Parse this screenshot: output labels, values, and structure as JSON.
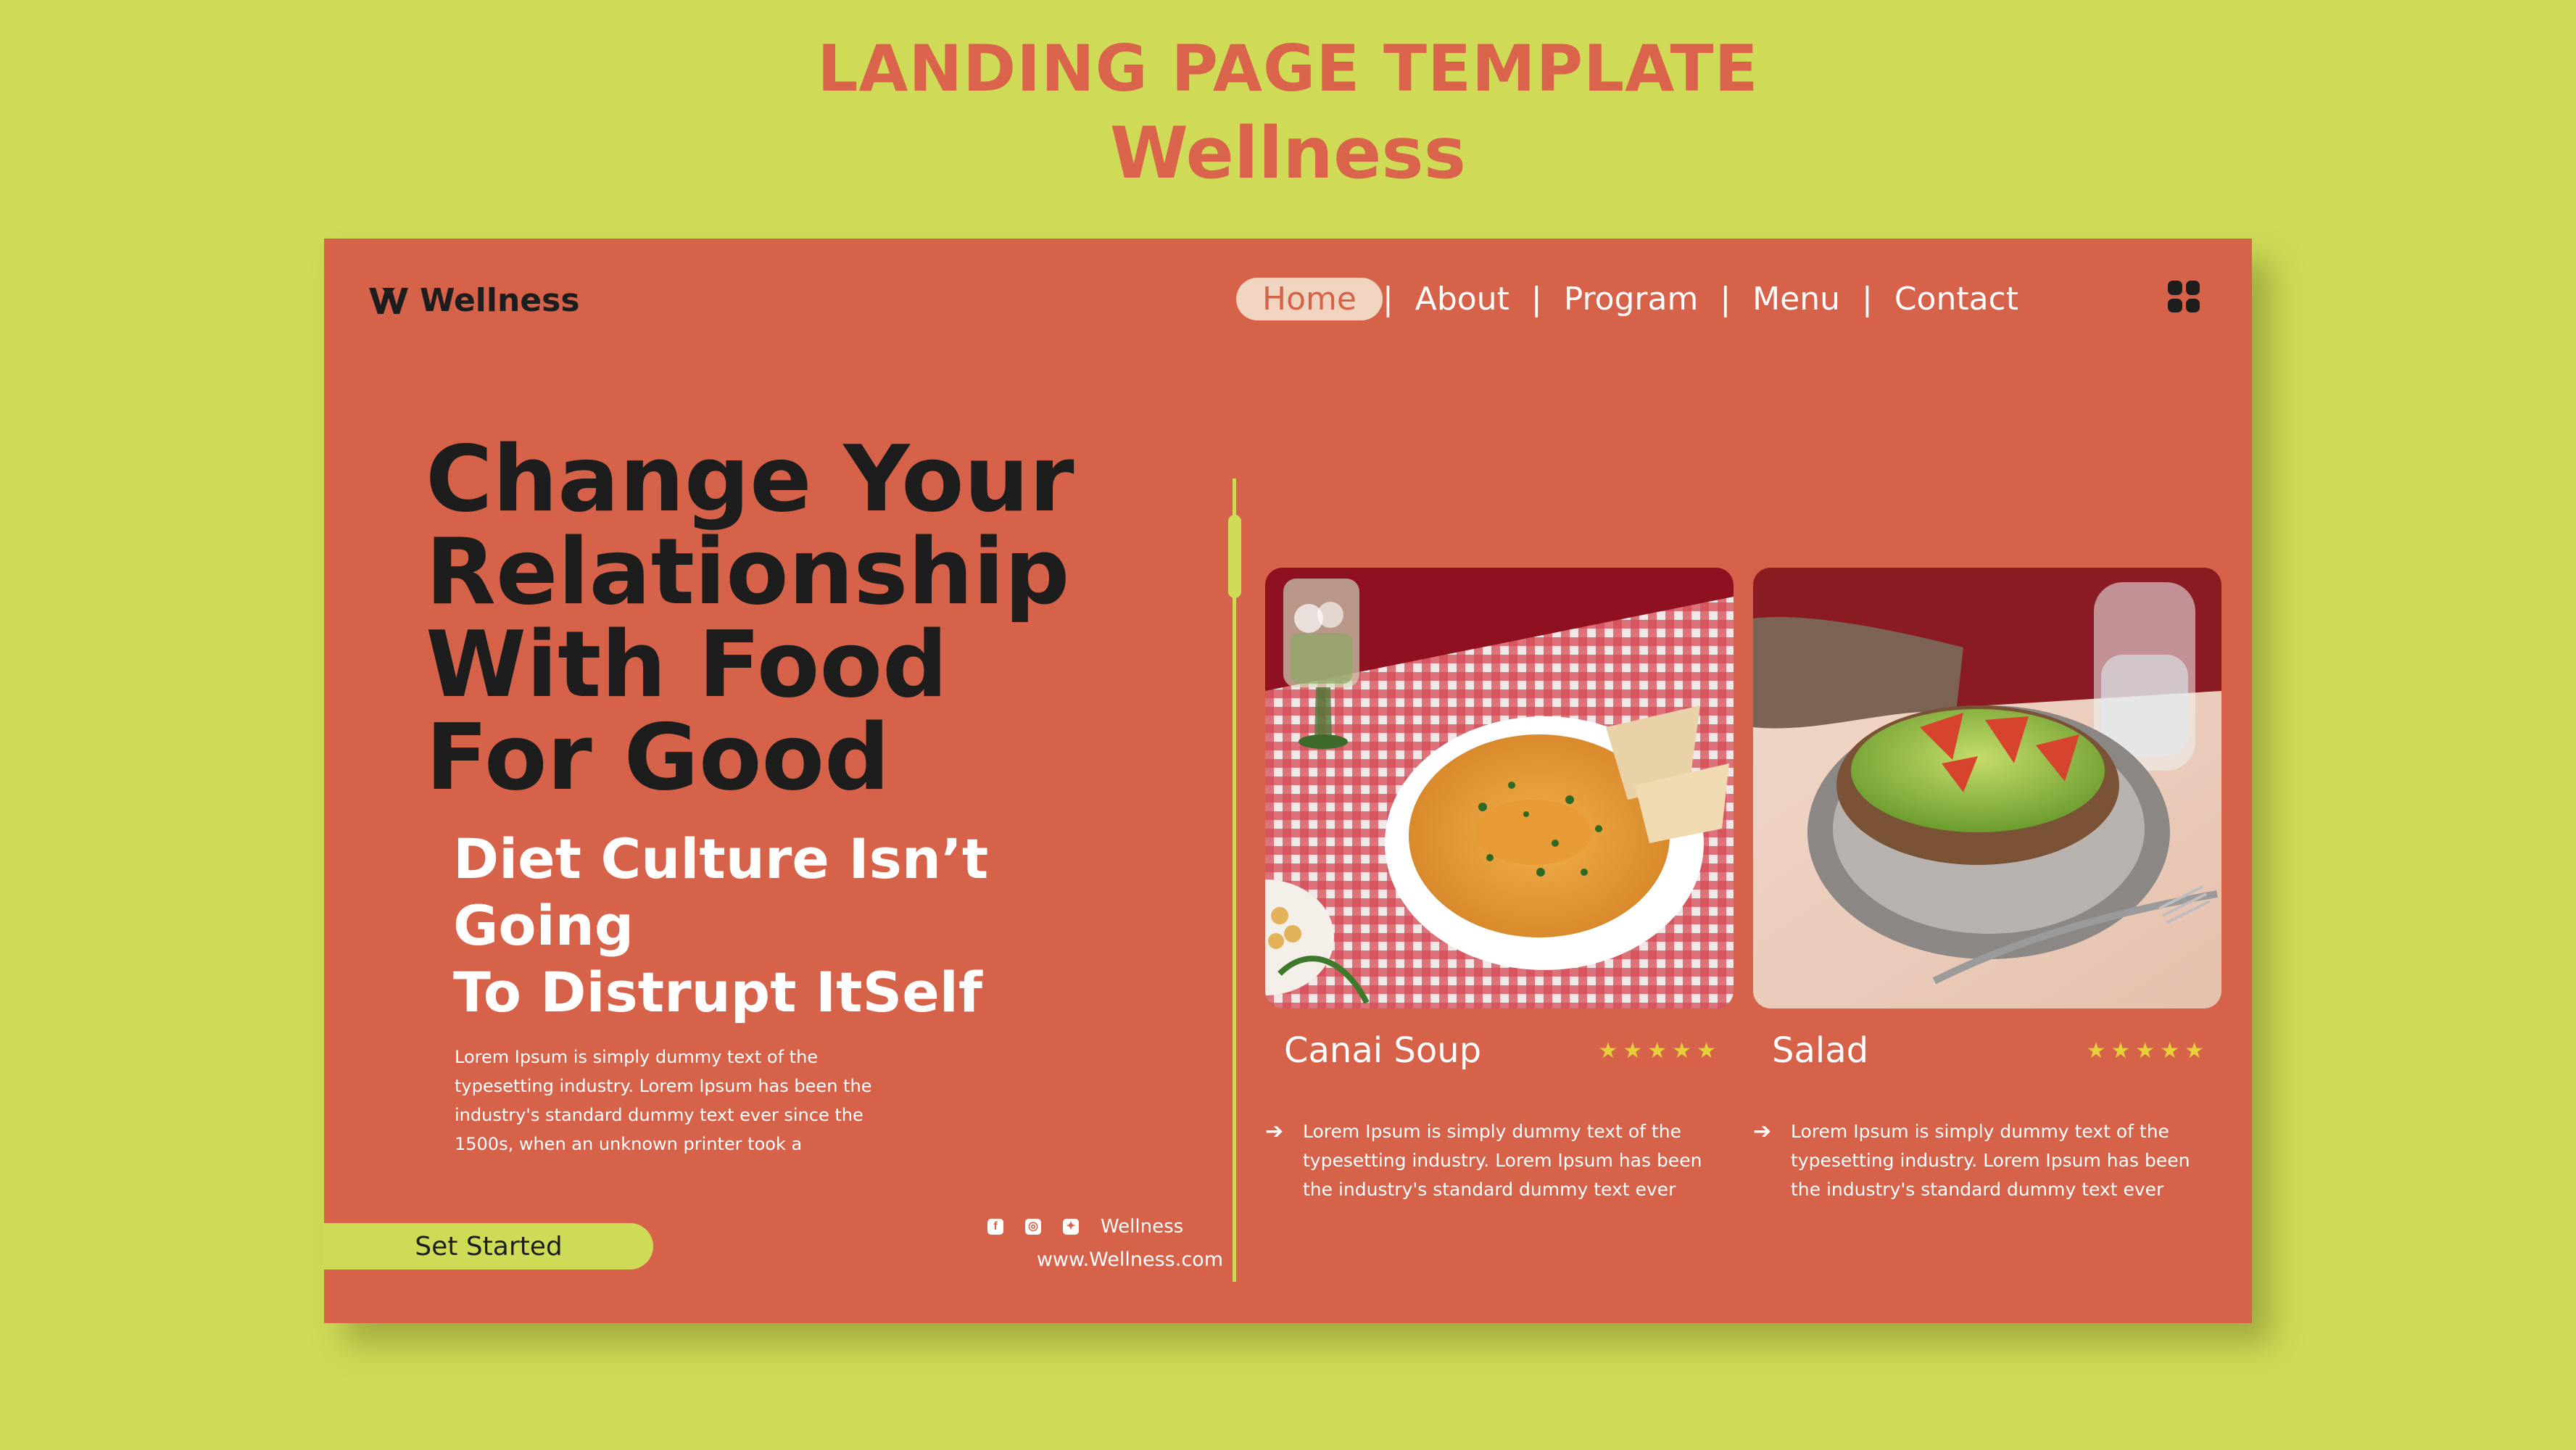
{
  "header": {
    "title": "LANDING PAGE TEMPLATE",
    "subtitle": "Wellness"
  },
  "brand": {
    "name": "Wellness",
    "logo_icon": "w-logo-icon"
  },
  "nav": {
    "items": [
      {
        "label": "Home",
        "active": true
      },
      {
        "label": "About"
      },
      {
        "label": "Program"
      },
      {
        "label": "Menu"
      },
      {
        "label": "Contact"
      }
    ],
    "separator": "|",
    "menu_icon": "grid-icon"
  },
  "hero": {
    "title_lines": [
      "Change Your",
      "Relationship",
      "With Food",
      "For Good"
    ],
    "subtitle_lines": [
      "Diet Culture Isn’t Going",
      "To Distrupt ItSelf"
    ],
    "body": "Lorem Ipsum is simply dummy text of the typesetting industry. Lorem Ipsum has been the industry's standard dummy text ever since the 1500s, when an unknown printer took a",
    "cta": "Set Started"
  },
  "footer": {
    "social_icons": [
      "facebook-icon",
      "instagram-icon",
      "twitter-icon"
    ],
    "social_name": "Wellness",
    "website": "www.Wellness.com"
  },
  "foods": [
    {
      "name": "Canai Soup",
      "rating": 5,
      "desc": "Lorem Ipsum is simply dummy text of the typesetting industry. Lorem Ipsum has been the industry's standard dummy text ever"
    },
    {
      "name": "Salad",
      "rating": 5,
      "desc": "Lorem Ipsum is simply dummy text of the typesetting industry. Lorem Ipsum has been the industry's standard dummy text ever"
    }
  ],
  "colors": {
    "background": "#cfdb57",
    "card": "#d6624a",
    "heading": "#d9634b",
    "accent": "#cfdb57",
    "star": "#e7cf3a"
  }
}
